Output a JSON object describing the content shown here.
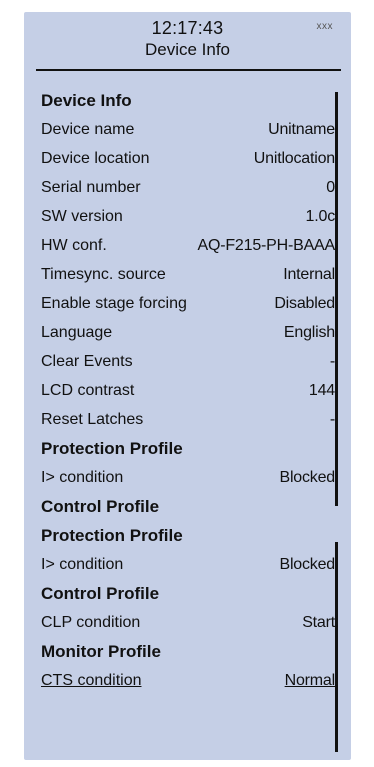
{
  "header": {
    "clock": "12:17:43",
    "indicator": "xxx",
    "title": "Device Info"
  },
  "rows": [
    {
      "label": "Device Info",
      "value": "",
      "heading": true
    },
    {
      "label": "Device name",
      "value": "Unitname"
    },
    {
      "label": "Device location",
      "value": "Unitlocation"
    },
    {
      "label": "Serial number",
      "value": "0"
    },
    {
      "label": "SW version",
      "value": "1.0c"
    },
    {
      "label": "HW conf.",
      "value": "AQ-F215-PH-BAAA"
    },
    {
      "label": "Timesync. source",
      "value": "Internal"
    },
    {
      "label": "Enable stage forcing",
      "value": "Disabled"
    },
    {
      "label": "Language",
      "value": "English"
    },
    {
      "label": "Clear Events",
      "value": "-"
    },
    {
      "label": "LCD contrast",
      "value": "144"
    },
    {
      "label": "Reset Latches",
      "value": "-"
    },
    {
      "label": "Protection Profile",
      "value": "",
      "heading": true
    },
    {
      "label": "I> condition",
      "value": "Blocked"
    },
    {
      "label": "Control Profile",
      "value": "",
      "heading": true
    },
    {
      "label": "Protection Profile",
      "value": "",
      "heading": true
    },
    {
      "label": "I> condition",
      "value": "Blocked"
    },
    {
      "label": "Control Profile",
      "value": "",
      "heading": true
    },
    {
      "label": "CLP condition",
      "value": "Start"
    },
    {
      "label": "Monitor Profile",
      "value": "",
      "heading": true
    },
    {
      "label": "CTS condition",
      "value": "Normal",
      "underline": true
    }
  ],
  "colors": {
    "panel_background": "#c5cfe6",
    "text": "#111111"
  },
  "icons": {
    "indicator": "status-indicator-icon",
    "scrollbar": "scrollbar"
  }
}
